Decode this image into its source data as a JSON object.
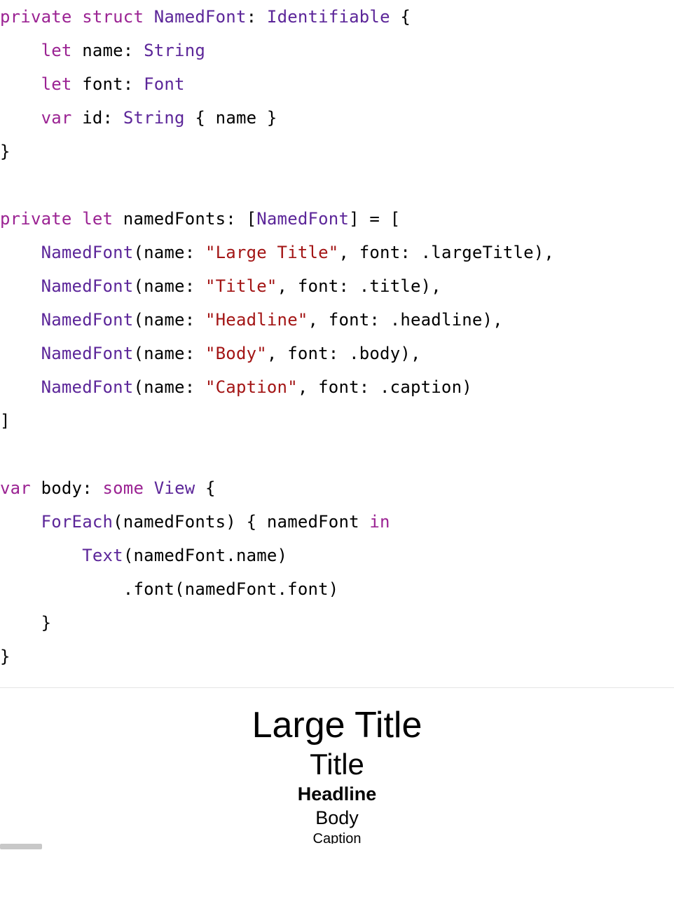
{
  "code": {
    "l1_private": "private",
    "l1_struct": "struct",
    "l1_name": "NamedFont",
    "l1_colon": ":",
    "l1_proto": "Identifiable",
    "l1_brace": " {",
    "l2_indent": "    ",
    "l2_let": "let",
    "l2_name": " name: ",
    "l2_type": "String",
    "l3_indent": "    ",
    "l3_let": "let",
    "l3_name": " font: ",
    "l3_type": "Font",
    "l4_indent": "    ",
    "l4_var": "var",
    "l4_name": " id: ",
    "l4_type": "String",
    "l4_body": " { name }",
    "l5": "}",
    "l7_private": "private",
    "l7_let": "let",
    "l7_name": " namedFonts: [",
    "l7_type": "NamedFont",
    "l7_end": "] = [",
    "arr1_indent": "    ",
    "arr1_ctor": "NamedFont",
    "arr1_open": "(name: ",
    "arr1_str": "\"Large Title\"",
    "arr1_rest": ", font: .largeTitle),",
    "arr2_indent": "    ",
    "arr2_ctor": "NamedFont",
    "arr2_open": "(name: ",
    "arr2_str": "\"Title\"",
    "arr2_rest": ", font: .title),",
    "arr3_indent": "    ",
    "arr3_ctor": "NamedFont",
    "arr3_open": "(name: ",
    "arr3_str": "\"Headline\"",
    "arr3_rest": ", font: .headline),",
    "arr4_indent": "    ",
    "arr4_ctor": "NamedFont",
    "arr4_open": "(name: ",
    "arr4_str": "\"Body\"",
    "arr4_rest": ", font: .body),",
    "arr5_indent": "    ",
    "arr5_ctor": "NamedFont",
    "arr5_open": "(name: ",
    "arr5_str": "\"Caption\"",
    "arr5_rest": ", font: .caption)",
    "arr_close": "]",
    "body_var": "var",
    "body_name": " body: ",
    "body_some": "some",
    "body_sp": " ",
    "body_view": "View",
    "body_brace": " {",
    "fe_indent": "    ",
    "fe_name": "ForEach",
    "fe_args": "(namedFonts) { namedFont ",
    "fe_in": "in",
    "txt_indent": "        ",
    "txt_name": "Text",
    "txt_args": "(namedFont.name)",
    "mod_indent": "            .font(namedFont.font)",
    "fe_close": "    }",
    "body_close": "}"
  },
  "preview": {
    "largeTitle": "Large Title",
    "title": "Title",
    "headline": "Headline",
    "body": "Body",
    "caption": "Caption"
  }
}
